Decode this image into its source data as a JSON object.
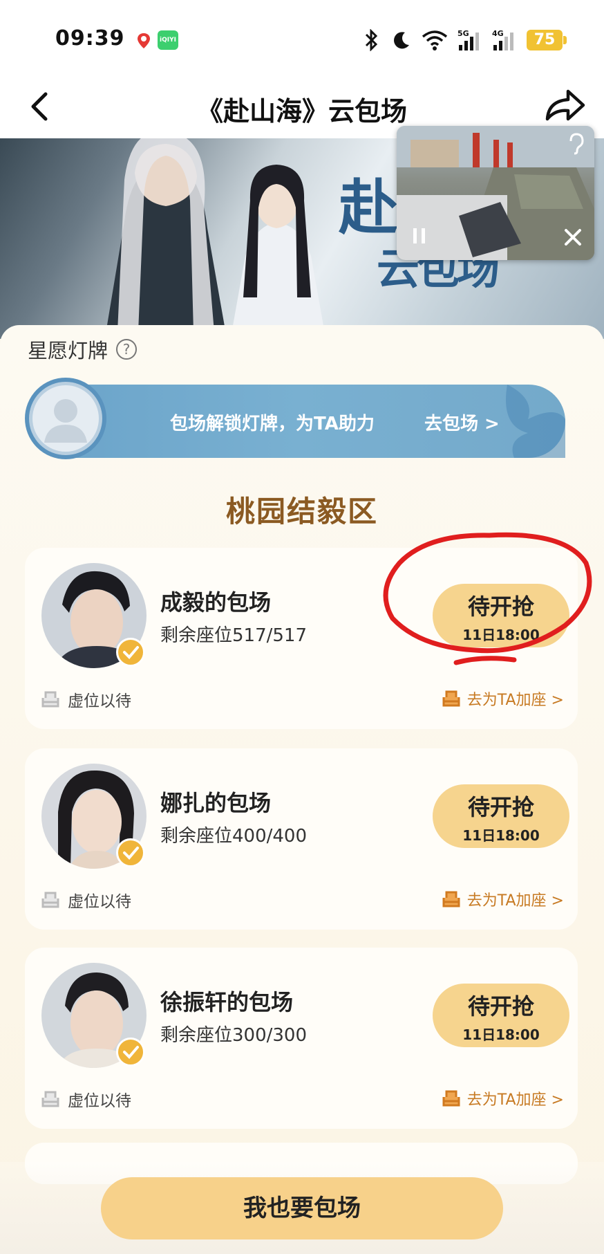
{
  "status_bar": {
    "time": "09:39",
    "network1": "5G",
    "network2": "4G",
    "battery": "75"
  },
  "header": {
    "title": "《赴山海》云包场"
  },
  "banner": {
    "calligraphy_top": "赴",
    "calligraphy_bottom": "云包场"
  },
  "section": {
    "title": "星愿灯牌",
    "unlock_text": "包场解锁灯牌，为TA助力",
    "unlock_go": "去包场 >"
  },
  "zone": {
    "title": "桃园结毅区"
  },
  "cards": [
    {
      "name": "成毅的包场",
      "seats": "剩余座位517/517",
      "button_label": "待开抢",
      "button_time": "11日18:00",
      "empty_seat": "虚位以待",
      "add_seat": "去为TA加座 >"
    },
    {
      "name": "娜扎的包场",
      "seats": "剩余座位400/400",
      "button_label": "待开抢",
      "button_time": "11日18:00",
      "empty_seat": "虚位以待",
      "add_seat": "去为TA加座 >"
    },
    {
      "name": "徐振轩的包场",
      "seats": "剩余座位300/300",
      "button_label": "待开抢",
      "button_time": "11日18:00",
      "empty_seat": "虚位以待",
      "add_seat": "去为TA加座 >"
    }
  ],
  "cta": {
    "label": "我也要包场"
  },
  "colors": {
    "accent": "#f6d48e",
    "zone_title": "#8b5a22",
    "unlock_bar": "#79b0d1",
    "annotation": "#e01e1e"
  }
}
